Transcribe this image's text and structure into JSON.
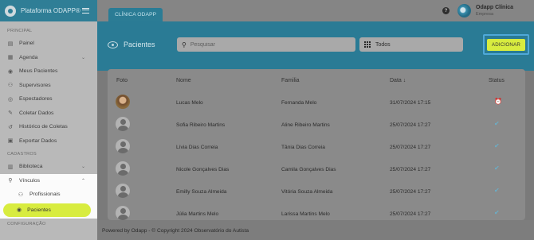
{
  "sidebar": {
    "brand": "Plataforma ODAPP®",
    "sections": {
      "principal": "PRINCIPAL",
      "cadastros": "CADASTROS",
      "configuracao": "CONFIGURAÇÃO"
    },
    "items": {
      "painel": "Painel",
      "agenda": "Agenda",
      "meus_pacientes": "Meus Pacientes",
      "supervisores": "Supervisores",
      "espectadores": "Espectadores",
      "coletar_dados": "Coletar Dados",
      "historico": "Histórico de Coletas",
      "exportar": "Exportar Dados",
      "biblioteca": "Biblioteca",
      "vinculos": "Vínculos",
      "profissionais": "Profissionais",
      "pacientes": "Pacientes"
    }
  },
  "topbar": {
    "tab": "CLÍNICA ODAPP",
    "user_name": "Odapp Clínica",
    "user_role": "Empresa"
  },
  "page": {
    "title": "Pacientes",
    "search_placeholder": "Pesquisar",
    "filter_value": "Todos",
    "add_label": "ADICIONAR"
  },
  "table": {
    "headers": {
      "foto": "Foto",
      "nome": "Nome",
      "familia": "Familia",
      "data": "Data",
      "status": "Status"
    },
    "rows": [
      {
        "nome": "Lucas Melo",
        "familia": "Fernanda Melo",
        "data": "31/07/2024 17:15"
      },
      {
        "nome": "Sofia Ribeiro Martins",
        "familia": "Aline Ribeiro Martins",
        "data": "25/07/2024 17:27"
      },
      {
        "nome": "Lívia Dias Correia",
        "familia": "Tânia Dias Correia",
        "data": "25/07/2024 17:27"
      },
      {
        "nome": "Nicole Gonçalves Dias",
        "familia": "Camila Gonçalves Dias",
        "data": "25/07/2024 17:27"
      },
      {
        "nome": "Emilly Souza Almeida",
        "familia": "Vitória Souza Almeida",
        "data": "25/07/2024 17:27"
      },
      {
        "nome": "Júlia Martins Melo",
        "familia": "Larissa Martins Melo",
        "data": "25/07/2024 17:27"
      }
    ]
  },
  "footer": {
    "text": "Powered by Odapp - © Copyright 2024 Observatório do Autista"
  },
  "colors": {
    "primary": "#2a7b95",
    "accent": "#d8ec3f",
    "highlight_border": "#4fa8d8"
  },
  "icons": {
    "menu": "hamburger-icon",
    "help": "help-icon",
    "search": "search-icon",
    "filter": "grid-icon",
    "status_pending": "clock-icon",
    "status_done": "check-icon"
  }
}
